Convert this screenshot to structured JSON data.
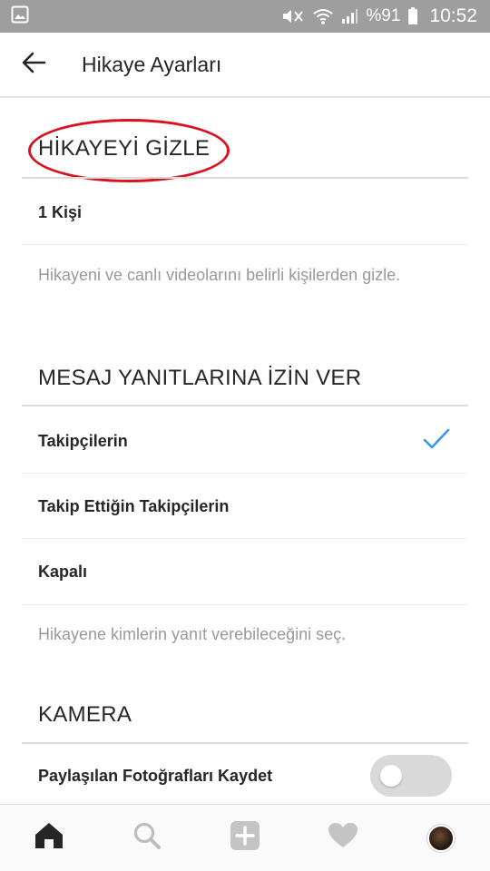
{
  "status_bar": {
    "battery": "%91",
    "time": "10:52",
    "icons": [
      "gallery-notification-icon",
      "mute-icon",
      "wifi-icon",
      "signal-icon",
      "battery-icon"
    ]
  },
  "app_bar": {
    "title": "Hikaye Ayarları",
    "back_icon": "back-arrow-icon"
  },
  "sections": {
    "hide_story": {
      "header": "HİKAYEYİ GİZLE",
      "item": "1 Kişi",
      "hint": "Hikayeni ve canlı videolarını belirli kişilerden gizle."
    },
    "replies": {
      "header": "MESAJ YANITLARINA İZİN VER",
      "options": [
        {
          "label": "Takipçilerin",
          "selected": true
        },
        {
          "label": "Takip Ettiğin Takipçilerin",
          "selected": false
        },
        {
          "label": "Kapalı",
          "selected": false
        }
      ],
      "hint": "Hikayene kimlerin yanıt verebileceğini seç."
    },
    "camera": {
      "header": "KAMERA",
      "item": "Paylaşılan Fotoğrafları Kaydet",
      "toggle_on": false
    }
  },
  "bottom_nav": [
    "home-icon",
    "search-icon",
    "add-post-icon",
    "activity-heart-icon",
    "profile-avatar"
  ],
  "colors": {
    "status_bar": "#9e9e9e",
    "check_accent": "#3897f0",
    "highlight": "#d8121f",
    "hint_text": "#999999",
    "toggle_off": "#d9d9d9"
  }
}
